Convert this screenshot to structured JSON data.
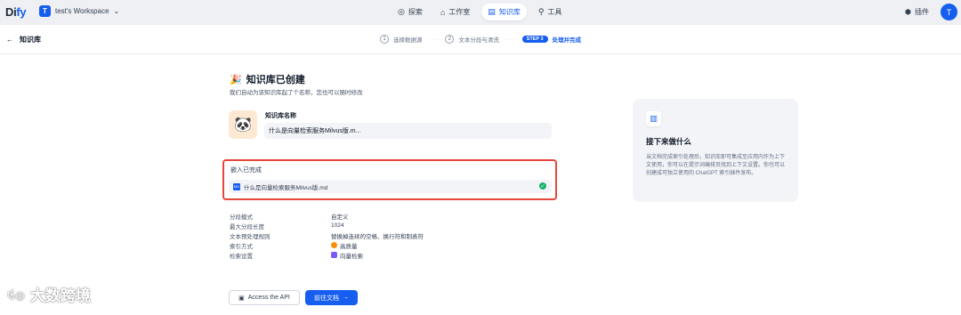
{
  "app": {
    "logo_main": "Di",
    "logo_accent": "fy"
  },
  "workspace": {
    "avatar": "T",
    "name": "test's Workspace"
  },
  "nav": [
    {
      "icon": "compass",
      "label": "探索"
    },
    {
      "icon": "app",
      "label": "工作室"
    },
    {
      "icon": "book",
      "label": "知识库"
    },
    {
      "icon": "tool",
      "label": "工具"
    }
  ],
  "top_right": {
    "plugins": "插件",
    "user_avatar": "T"
  },
  "page": {
    "back_label": "知识库"
  },
  "steps": [
    {
      "num": "1",
      "label": "选择数据源"
    },
    {
      "num": "2",
      "label": "文本分段与清洗"
    },
    {
      "num": "STEP 3",
      "label": "处理并完成"
    }
  ],
  "created": {
    "title": "知识库已创建",
    "subtitle": "我们自动为该知识库起了个名称，您也可以随时修改",
    "name_label": "知识库名称",
    "name_value": "什么是向量检索服务Milvus版.m..."
  },
  "embedding": {
    "title": "嵌入已完成",
    "file_name": "什么是向量检索服务Milvus版.md",
    "status": "complete"
  },
  "properties": [
    {
      "key": "分段模式",
      "value": "自定义"
    },
    {
      "key": "最大分段长度",
      "value": "1024"
    },
    {
      "key": "文本预处理规则",
      "value": "替换掉连续的空格、换行符和制表符"
    },
    {
      "key": "索引方式",
      "value": "高质量",
      "icon": "orange"
    },
    {
      "key": "检索设置",
      "value": "向量检索",
      "icon": "purple"
    }
  ],
  "buttons": {
    "api": "Access the API",
    "docs": "前往文档"
  },
  "next_card": {
    "title": "接下来做什么",
    "text": "当文档完成索引处理后，知识库即可集成至应用内作为上下文使用，你可以在提示词编排页找到上下文设置。你也可以创建成可独立使用的 ChatGPT 索引插件发布。"
  },
  "watermark": {
    "text": "大数跨境"
  }
}
